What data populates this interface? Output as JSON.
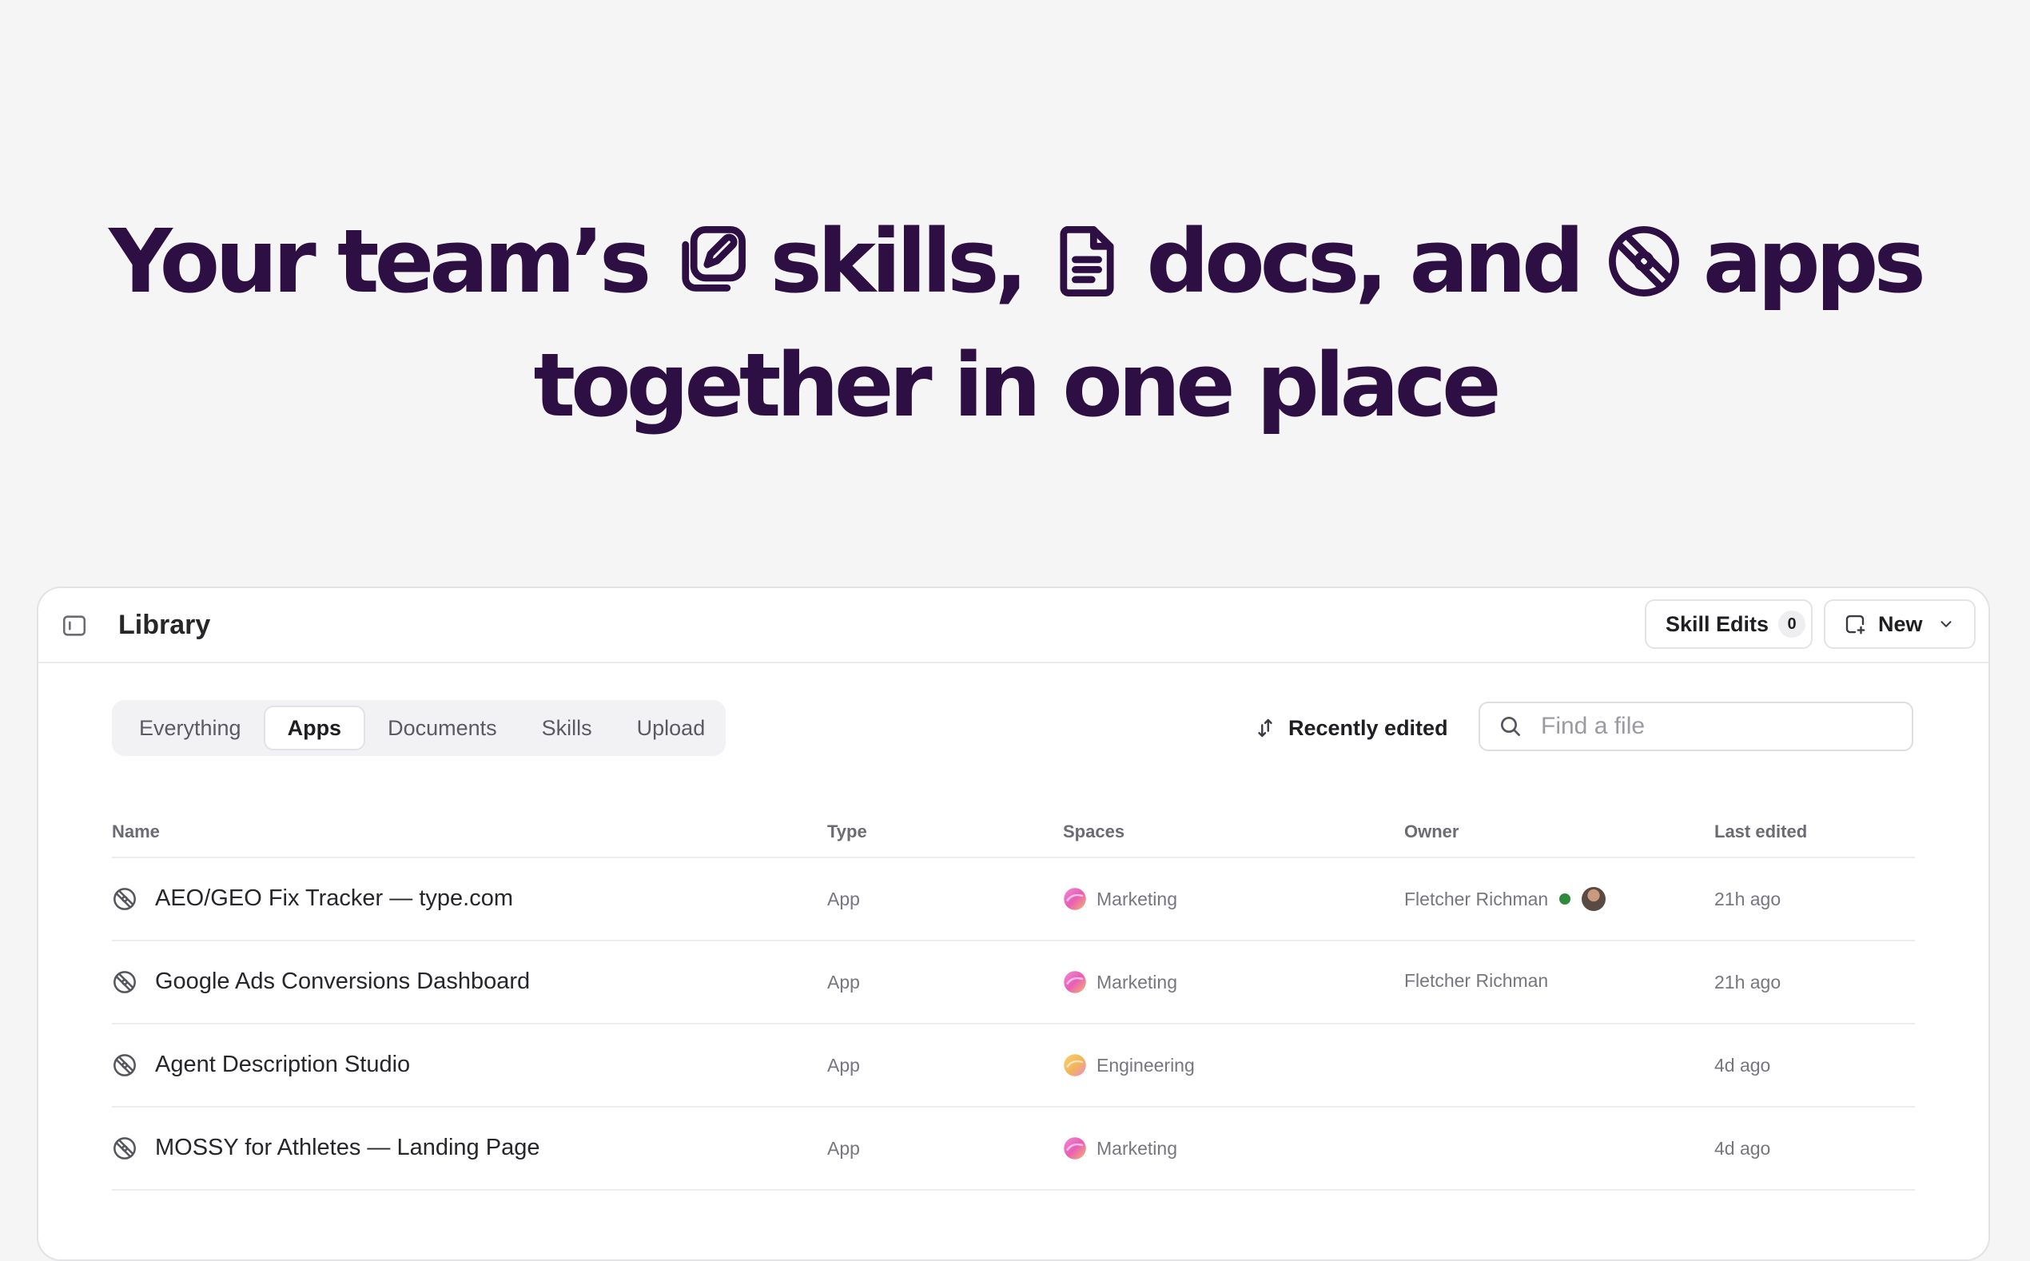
{
  "hero": {
    "part1": "Your team’s",
    "part2": "skills,",
    "part3": "docs, and",
    "part4": "apps",
    "line2": "together in one place",
    "icons": [
      "skill-edit-icon",
      "document-icon",
      "app-icon"
    ]
  },
  "library": {
    "title": "Library",
    "skill_edits_label": "Skill Edits",
    "skill_edits_count": "0",
    "new_label": "New",
    "tabs": [
      {
        "label": "Everything",
        "active": false
      },
      {
        "label": "Apps",
        "active": true
      },
      {
        "label": "Documents",
        "active": false
      },
      {
        "label": "Skills",
        "active": false
      },
      {
        "label": "Upload",
        "active": false
      }
    ],
    "sort_label": "Recently edited",
    "search_placeholder": "Find a file",
    "columns": {
      "name": "Name",
      "type": "Type",
      "spaces": "Spaces",
      "owner": "Owner",
      "last_edited": "Last edited"
    },
    "rows": [
      {
        "name": "AEO/GEO Fix Tracker — type.com",
        "type": "App",
        "space": "Marketing",
        "owner": "Fletcher Richman",
        "online": true,
        "avatar": true,
        "edited": "21h ago"
      },
      {
        "name": "Google Ads Conversions Dashboard",
        "type": "App",
        "space": "Marketing",
        "owner": "Fletcher Richman",
        "online": false,
        "avatar": false,
        "edited": "21h ago"
      },
      {
        "name": "Agent Description Studio",
        "type": "App",
        "space": "Engineering",
        "owner": "",
        "online": false,
        "avatar": false,
        "edited": "4d ago"
      },
      {
        "name": "MOSSY for Athletes — Landing Page",
        "type": "App",
        "space": "Marketing",
        "owner": "",
        "online": false,
        "avatar": false,
        "edited": "4d ago"
      }
    ]
  },
  "colors": {
    "hero_text": "#2e0f44",
    "marketing_space": "#e85fb8",
    "engineering_space": "#f2b25b",
    "online": "#2f8a3c"
  }
}
